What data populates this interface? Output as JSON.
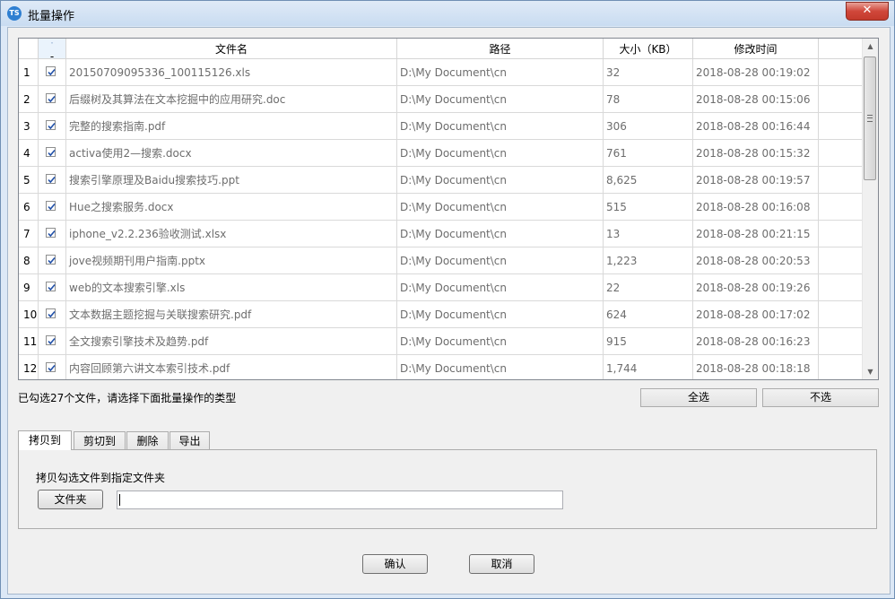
{
  "window": {
    "title": "批量操作",
    "icon_label": "TS",
    "close_symbol": "✕"
  },
  "table": {
    "headers": {
      "file_name": "文件名",
      "path": "路径",
      "size": "大小（KB）",
      "modified": "修改时间",
      "sort_indicator": "-"
    },
    "rows": [
      {
        "index": "1",
        "checked": true,
        "name": "20150709095336_100115126.xls",
        "path": "D:\\My Document\\cn",
        "size": "32",
        "modified": "2018-08-28 00:19:02"
      },
      {
        "index": "2",
        "checked": true,
        "name": "后缀树及其算法在文本挖掘中的应用研究.doc",
        "path": "D:\\My Document\\cn",
        "size": "78",
        "modified": "2018-08-28 00:15:06"
      },
      {
        "index": "3",
        "checked": true,
        "name": "完整的搜索指南.pdf",
        "path": "D:\\My Document\\cn",
        "size": "306",
        "modified": "2018-08-28 00:16:44"
      },
      {
        "index": "4",
        "checked": true,
        "name": "activa使用2—搜索.docx",
        "path": "D:\\My Document\\cn",
        "size": "761",
        "modified": "2018-08-28 00:15:32"
      },
      {
        "index": "5",
        "checked": true,
        "name": "搜索引擎原理及Baidu搜索技巧.ppt",
        "path": "D:\\My Document\\cn",
        "size": "8,625",
        "modified": "2018-08-28 00:19:57"
      },
      {
        "index": "6",
        "checked": true,
        "name": "Hue之搜索服务.docx",
        "path": "D:\\My Document\\cn",
        "size": "515",
        "modified": "2018-08-28 00:16:08"
      },
      {
        "index": "7",
        "checked": true,
        "name": "iphone_v2.2.236验收测试.xlsx",
        "path": "D:\\My Document\\cn",
        "size": "13",
        "modified": "2018-08-28 00:21:15"
      },
      {
        "index": "8",
        "checked": true,
        "name": "jove视频期刊用户指南.pptx",
        "path": "D:\\My Document\\cn",
        "size": "1,223",
        "modified": "2018-08-28 00:20:53"
      },
      {
        "index": "9",
        "checked": true,
        "name": "web的文本搜索引擎.xls",
        "path": "D:\\My Document\\cn",
        "size": "22",
        "modified": "2018-08-28 00:19:26"
      },
      {
        "index": "10",
        "checked": true,
        "name": "文本数据主题挖掘与关联搜索研究.pdf",
        "path": "D:\\My Document\\cn",
        "size": "624",
        "modified": "2018-08-28 00:17:02"
      },
      {
        "index": "11",
        "checked": true,
        "name": "全文搜索引擎技术及趋势.pdf",
        "path": "D:\\My Document\\cn",
        "size": "915",
        "modified": "2018-08-28 00:16:23"
      },
      {
        "index": "12",
        "checked": true,
        "name": "内容回顾第六讲文本索引技术.pdf",
        "path": "D:\\My Document\\cn",
        "size": "1,744",
        "modified": "2018-08-28 00:18:18"
      }
    ]
  },
  "status_text": "已勾选27个文件，请选择下面批量操作的类型",
  "select_all_label": "全选",
  "select_none_label": "不选",
  "tabs": [
    "拷贝到",
    "剪切到",
    "删除",
    "导出"
  ],
  "active_tab": "拷贝到",
  "copy_panel": {
    "label": "拷贝勾选文件到指定文件夹",
    "folder_button": "文件夹",
    "folder_value": ""
  },
  "footer": {
    "ok_label": "确认",
    "cancel_label": "取消"
  },
  "colors": {
    "accent": "#2f7fd1",
    "close_red": "#c33a2c",
    "check_blue": "#1f4fa8"
  }
}
